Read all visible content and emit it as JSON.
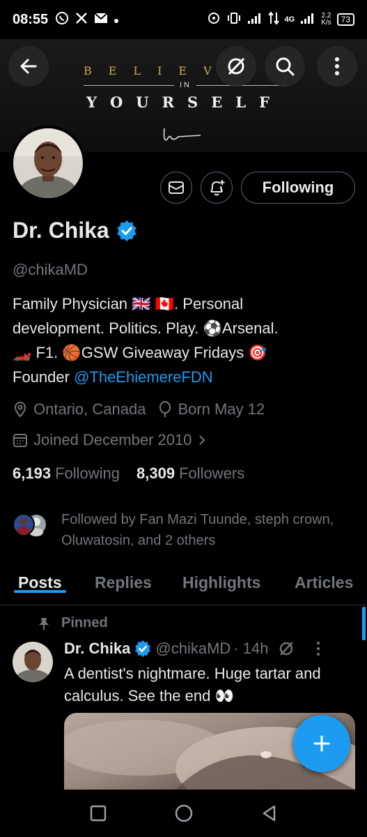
{
  "status_bar": {
    "time": "08:55",
    "network_label": "4G",
    "speed_value": "2.2",
    "speed_unit": "K/s",
    "battery": "73"
  },
  "banner": {
    "line1": "BELIEVE",
    "line2": "IN",
    "line3": "YOURSELF"
  },
  "profile": {
    "name": "Dr. Chika",
    "handle": "@chikaMD",
    "bio_line1": "Family Physician 🇬🇧 🇨🇦. Personal",
    "bio_line2": "development. Politics. Play. ⚽Arsenal.",
    "bio_line3": "🏎️ F1. 🏀GSW  Giveaway Fridays 🎯",
    "bio_line4_prefix": "Founder ",
    "bio_link": "@TheEhiemereFDN",
    "location": "Ontario, Canada",
    "birthday": "Born May 12",
    "joined": "Joined December 2010",
    "following_count": "6,193",
    "following_label": "Following",
    "followers_count": "8,309",
    "followers_label": "Followers",
    "followed_by": "Followed by Fan Mazi Tuunde, steph crown, Oluwatosin, and 2 others",
    "following_button": "Following"
  },
  "tabs": [
    "Posts",
    "Replies",
    "Highlights",
    "Articles"
  ],
  "active_tab": "Posts",
  "post": {
    "pinned_label": "Pinned",
    "author_name": "Dr. Chika",
    "author_handle": "@chikaMD",
    "time": "· 14h",
    "text": "A dentist's nightmare. Huge tartar and calculus. See the end 👀"
  },
  "colors": {
    "accent": "#1d9bf0",
    "text": "#e7e9ea",
    "muted": "#71767b",
    "border": "#536471"
  }
}
